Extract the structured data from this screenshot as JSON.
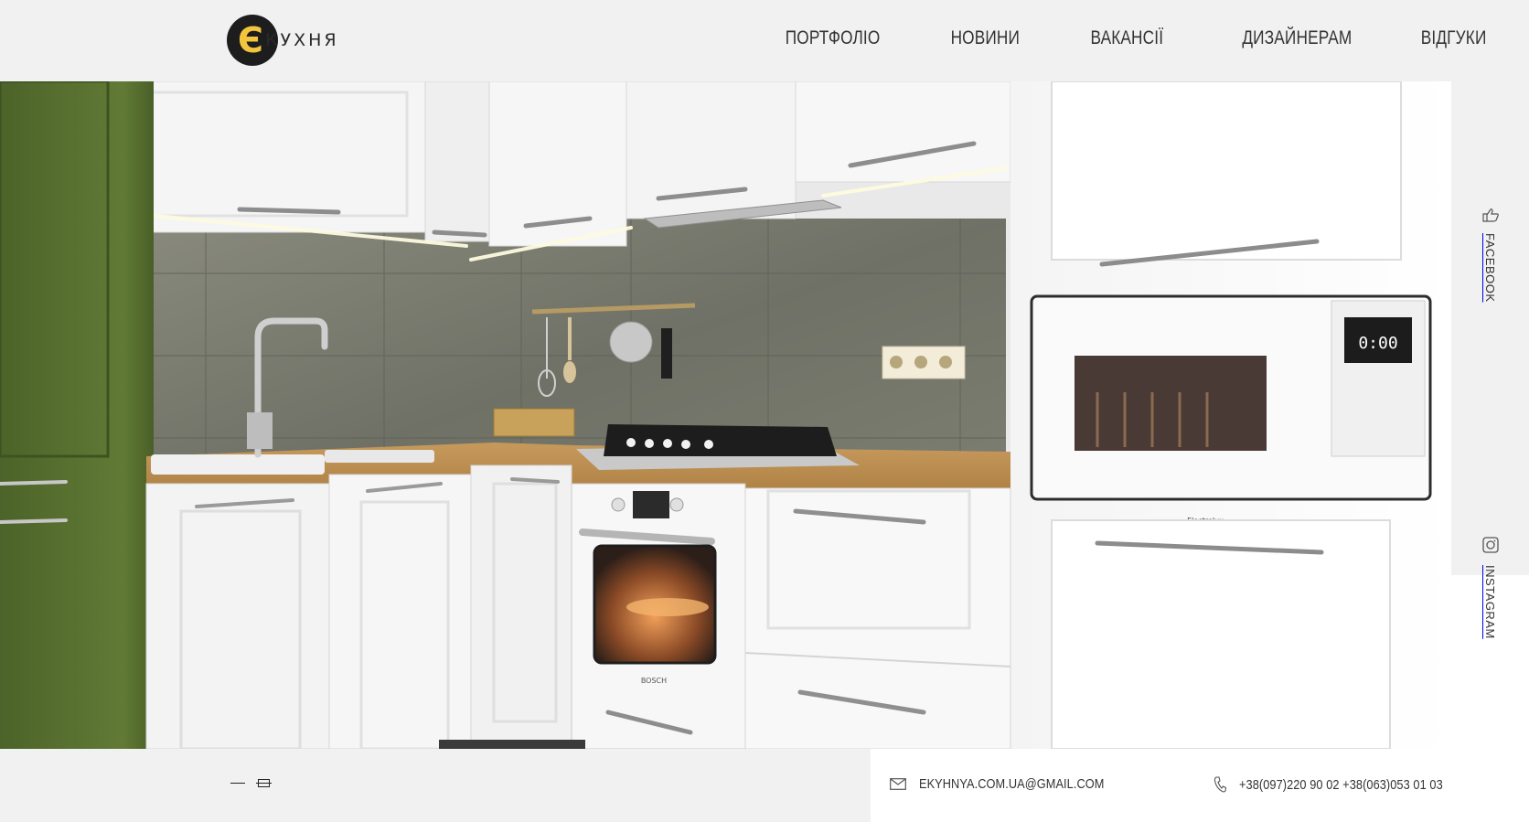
{
  "logo": {
    "letter": "Є",
    "word": "КУХНЯ"
  },
  "nav": {
    "items": [
      "ПОРТФОЛІО",
      "НОВИНИ",
      "ВАКАНСІЇ",
      "ДИЗАЙНЕРАМ",
      "ВІДГУКИ"
    ]
  },
  "hero": {
    "microwave_display": "0:00",
    "microwave_brand": "Electrolux",
    "oven_brand": "BOSCH"
  },
  "social": {
    "facebook": "FACEBOOK",
    "instagram": "INSTAGRAM"
  },
  "contacts": {
    "email": "EKYHNYA.COM.UA@GMAIL.COM",
    "phone": "+38(097)220 90 02 +38(063)053 01 03"
  },
  "icons": {
    "logo": "logo-badge",
    "facebook": "thumbs-up-icon",
    "instagram": "instagram-icon",
    "email": "envelope-icon",
    "phone": "phone-icon",
    "slider_prev": "minus-icon",
    "slider_next": "box-icon"
  },
  "colors": {
    "header_bg": "#f1f1f1",
    "logo_accent": "#f2c53d",
    "logo_dark": "#1d1d1d",
    "cabinet_green": "#5a7232",
    "backsplash": "#7d7f72"
  }
}
